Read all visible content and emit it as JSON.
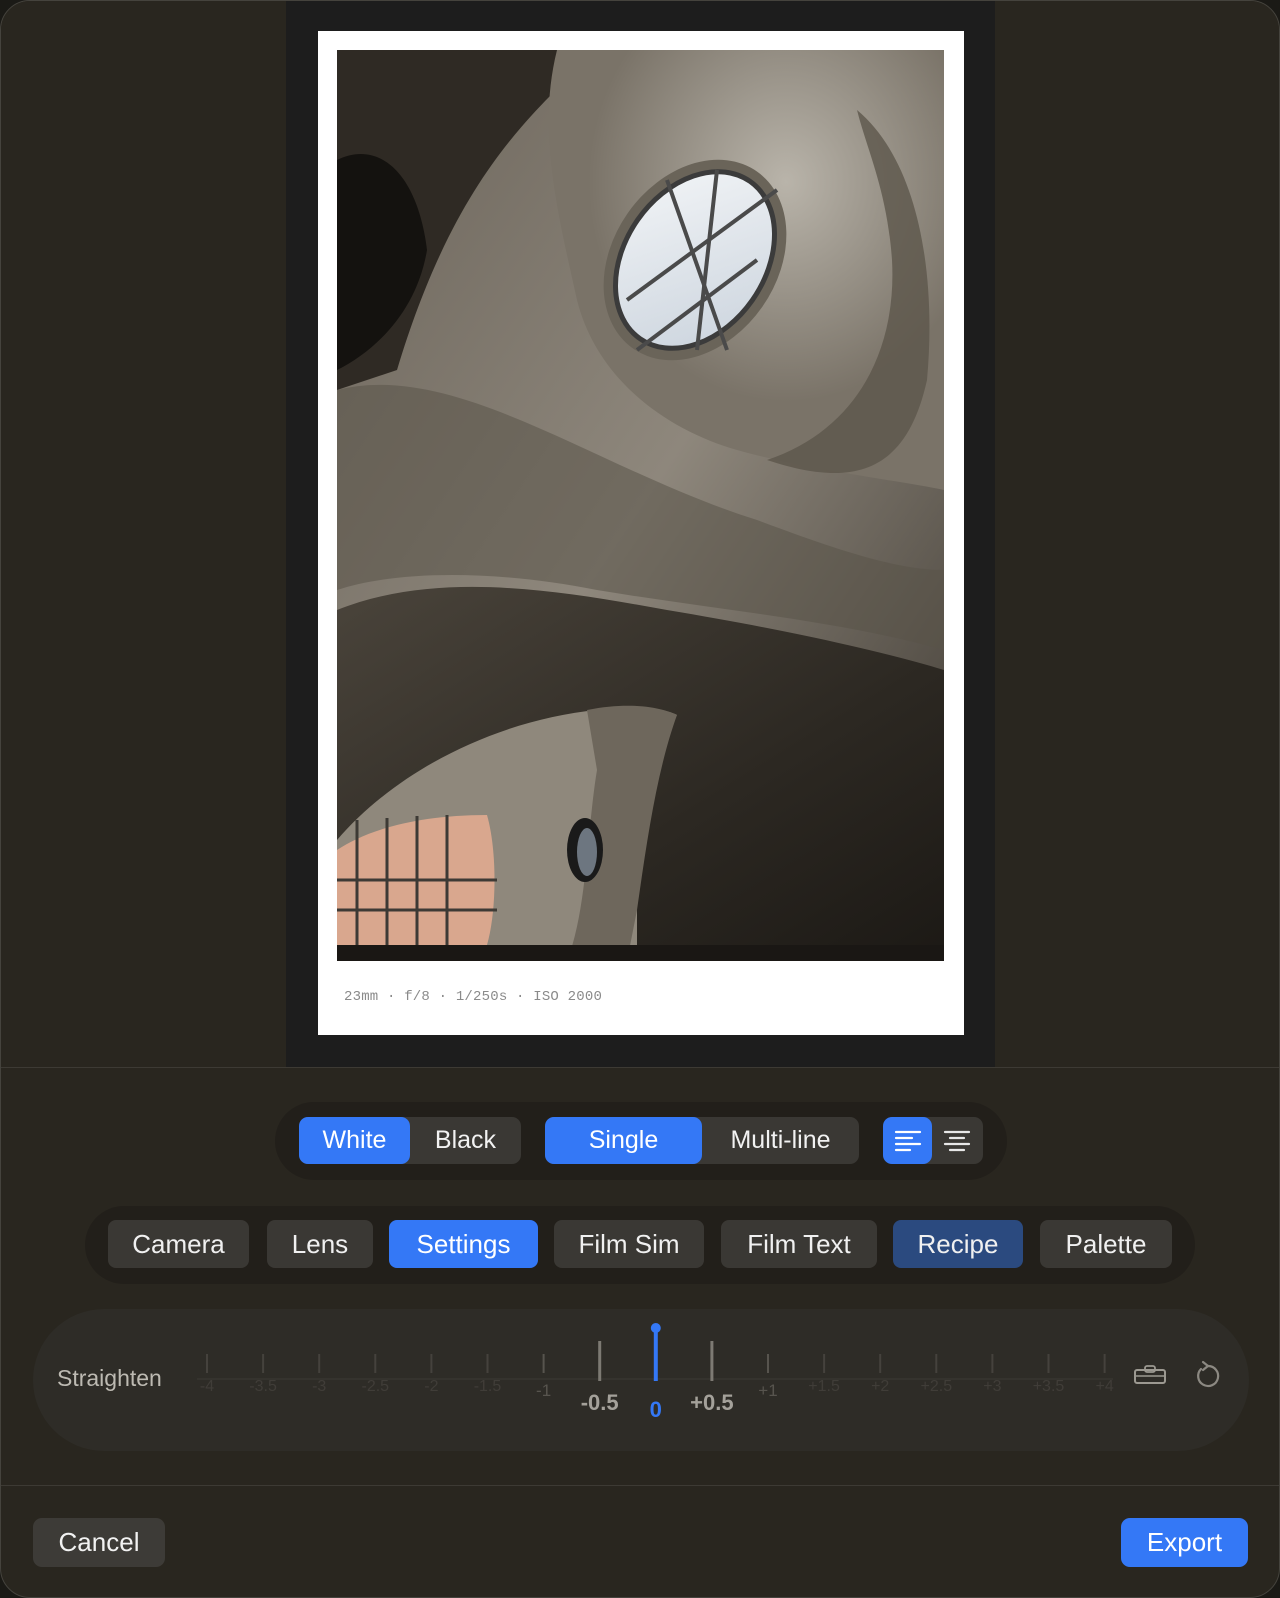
{
  "preview": {
    "exif_text": "23mm · f/8 · 1/250s · ISO 2000"
  },
  "frame_color": {
    "options": [
      "White",
      "Black"
    ],
    "selected": "White"
  },
  "layout_mode": {
    "options": [
      "Single",
      "Multi-line"
    ],
    "selected": "Single"
  },
  "text_alignment": {
    "options": [
      "align-left-icon",
      "align-center-icon"
    ],
    "selected": "align-left"
  },
  "tabs": {
    "items": [
      "Camera",
      "Lens",
      "Settings",
      "Film Sim",
      "Film Text",
      "Recipe",
      "Palette"
    ],
    "active": "Settings",
    "secondary_selected": "Recipe"
  },
  "straighten": {
    "label": "Straighten",
    "ticks": [
      "-4",
      "-3.5",
      "-3",
      "-2.5",
      "-2",
      "-1.5",
      "-1",
      "-0.5",
      "0",
      "+0.5",
      "+1",
      "+1.5",
      "+2",
      "+2.5",
      "+3",
      "+3.5",
      "+4"
    ],
    "value": 0,
    "level_icon": "level-icon",
    "reset_icon": "reset-icon"
  },
  "footer": {
    "cancel_label": "Cancel",
    "export_label": "Export"
  },
  "colors": {
    "accent": "#3478f6",
    "accent_dim": "#2b4a7f",
    "background": "#29261f"
  }
}
